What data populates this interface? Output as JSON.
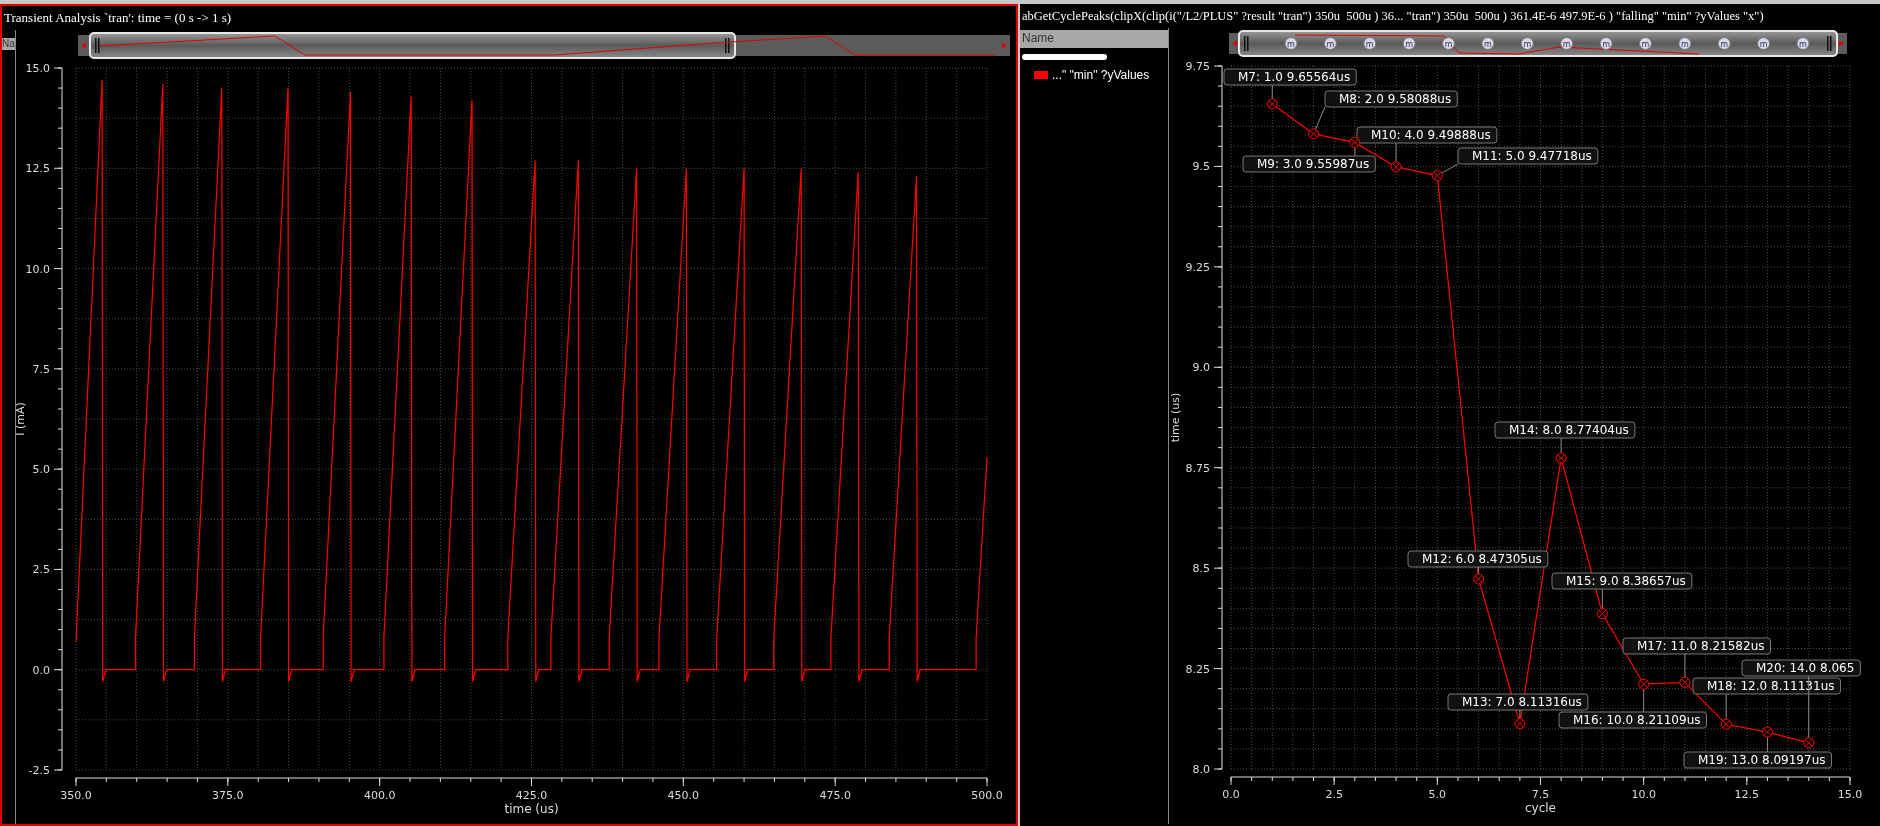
{
  "left_panel": {
    "title": "Transient Analysis `tran': time = (0 s -> 1 s)",
    "legend": {
      "header": "Na"
    },
    "chart_data": {
      "type": "line",
      "grid": true,
      "xlabel": "time (us)",
      "ylabel": "I (mA)",
      "x": [
        350,
        354.3,
        354.4,
        354.9,
        359.8,
        359.8,
        364.3,
        364.4,
        364.9,
        369.5,
        369.5,
        374.0,
        374.1,
        374.6,
        380.4,
        380.4,
        384.9,
        385.0,
        385.5,
        390.7,
        390.7,
        395.2,
        395.3,
        395.8,
        400.7,
        400.7,
        405.2,
        405.3,
        405.8,
        410.7,
        410.7,
        415.2,
        415.3,
        415.8,
        421.1,
        421.1,
        425.6,
        425.7,
        426.2,
        428.2,
        428.2,
        432.7,
        432.8,
        433.3,
        437.8,
        437.8,
        442.3,
        442.4,
        442.9,
        446.0,
        446.0,
        450.5,
        450.6,
        451.1,
        455.5,
        455.5,
        460.0,
        460.1,
        460.6,
        464.9,
        464.9,
        469.4,
        469.5,
        470.0,
        474.3,
        474.3,
        478.8,
        478.9,
        479.4,
        483.9,
        483.9,
        488.4,
        488.5,
        489.0,
        498.2,
        498.2,
        500
      ],
      "series": [
        {
          "color": "#ff0000",
          "values": [
            0.7,
            14.7,
            -0.3,
            0,
            0,
            0.8,
            14.6,
            -0.3,
            0,
            0,
            0.8,
            14.5,
            -0.3,
            0,
            0,
            0.8,
            14.5,
            -0.3,
            0,
            0,
            0.8,
            14.4,
            -0.3,
            0,
            0,
            0.8,
            14.3,
            -0.3,
            0,
            0,
            0.8,
            14.2,
            -0.3,
            0,
            0,
            0.8,
            12.7,
            -0.3,
            0,
            0,
            0.8,
            12.7,
            -0.3,
            0,
            0,
            0.8,
            12.5,
            -0.3,
            0,
            0,
            0.8,
            12.5,
            -0.3,
            0,
            0,
            0.8,
            12.5,
            -0.3,
            0,
            0,
            0.8,
            12.5,
            -0.3,
            0,
            0,
            0.8,
            12.4,
            -0.3,
            0,
            0,
            0.8,
            12.3,
            -0.3,
            0,
            0,
            0.8,
            5.3
          ]
        }
      ],
      "xlim": [
        350,
        500
      ],
      "ylim": [
        -2.5,
        15
      ],
      "xticks": [
        {
          "value": 350,
          "label": "350.0"
        },
        {
          "value": 375,
          "label": "375.0"
        },
        {
          "value": 400,
          "label": "400.0"
        },
        {
          "value": 425,
          "label": "425.0"
        },
        {
          "value": 450,
          "label": "450.0"
        },
        {
          "value": 475,
          "label": "475.0"
        },
        {
          "value": 500,
          "label": "500.0"
        }
      ],
      "yticks": [
        {
          "value": -2.5,
          "label": "-2.5"
        },
        {
          "value": 0,
          "label": "0.0"
        },
        {
          "value": 2.5,
          "label": "2.5"
        },
        {
          "value": 5,
          "label": "5.0"
        },
        {
          "value": 7.5,
          "label": "7.5"
        },
        {
          "value": 10,
          "label": "10.0"
        },
        {
          "value": 12.5,
          "label": "12.5"
        },
        {
          "value": 15,
          "label": "15.0"
        }
      ]
    }
  },
  "right_panel": {
    "title": "abGetCyclePeaks(clipX(clip(i(\"/L2/PLUS\" ?result \"tran\") 350u  500u ) 36... \"tran\") 350u  500u ) 361.4E-6 497.9E-6 ) \"falling\" \"min\" ?yValues \"x\")",
    "legend": {
      "header": "Name",
      "items": [
        {
          "label": "...\" \"min\" ?yValues",
          "color": "#ff0000"
        }
      ]
    },
    "overview": {
      "markers": [
        "m",
        "m",
        "m",
        "m",
        "m",
        "m",
        "m",
        "m",
        "m",
        "m",
        "m",
        "m",
        "m",
        "m"
      ]
    },
    "chart_data": {
      "type": "line",
      "grid": true,
      "xlabel": "cycle",
      "ylabel": "time (us)",
      "x": [
        1,
        2,
        3,
        4,
        5,
        6,
        7,
        8,
        9,
        10,
        11,
        12,
        13,
        14
      ],
      "series": [
        {
          "color": "#ff0000",
          "marker": "circle-x",
          "values": [
            9.65564,
            9.58088,
            9.55987,
            9.49888,
            9.47718,
            8.47305,
            8.11316,
            8.77404,
            8.38657,
            8.21109,
            8.21582,
            8.11131,
            8.09197,
            8.0652
          ]
        }
      ],
      "xlim": [
        0,
        15
      ],
      "ylim": [
        8,
        9.75
      ],
      "xticks": [
        {
          "value": 0,
          "label": "0.0"
        },
        {
          "value": 2.5,
          "label": "2.5"
        },
        {
          "value": 5,
          "label": "5.0"
        },
        {
          "value": 7.5,
          "label": "7.5"
        },
        {
          "value": 10,
          "label": "10.0"
        },
        {
          "value": 12.5,
          "label": "12.5"
        },
        {
          "value": 15,
          "label": "15.0"
        }
      ],
      "yticks": [
        {
          "value": 8,
          "label": "8.0"
        },
        {
          "value": 8.25,
          "label": "8.25"
        },
        {
          "value": 8.5,
          "label": "8.5"
        },
        {
          "value": 8.75,
          "label": "8.75"
        },
        {
          "value": 9,
          "label": "9.0"
        },
        {
          "value": 9.25,
          "label": "9.25"
        },
        {
          "value": 9.5,
          "label": "9.5"
        },
        {
          "value": 9.75,
          "label": "9.75"
        }
      ],
      "annotations": [
        {
          "x": 1,
          "y": 9.65564,
          "text": "M7: 1.0 9.65564us"
        },
        {
          "x": 2,
          "y": 9.58088,
          "text": "M8: 2.0 9.58088us"
        },
        {
          "x": 3,
          "y": 9.55987,
          "text": "M9: 3.0 9.55987us"
        },
        {
          "x": 4,
          "y": 9.49888,
          "text": "M10: 4.0 9.49888us"
        },
        {
          "x": 5,
          "y": 9.47718,
          "text": "M11: 5.0 9.47718us"
        },
        {
          "x": 6,
          "y": 8.47305,
          "text": "M12: 6.0 8.47305us"
        },
        {
          "x": 7,
          "y": 8.11316,
          "text": "M13: 7.0 8.11316us"
        },
        {
          "x": 8,
          "y": 8.77404,
          "text": "M14: 8.0 8.77404us"
        },
        {
          "x": 9,
          "y": 8.38657,
          "text": "M15: 9.0 8.38657us"
        },
        {
          "x": 10,
          "y": 8.21109,
          "text": "M16: 10.0 8.21109us"
        },
        {
          "x": 11,
          "y": 8.21582,
          "text": "M17: 11.0 8.21582us"
        },
        {
          "x": 12,
          "y": 8.11131,
          "text": "M18: 12.0 8.11131us"
        },
        {
          "x": 13,
          "y": 8.09197,
          "text": "M19: 13.0 8.09197us"
        },
        {
          "x": 14,
          "y": 8.0652,
          "text": "M20: 14.0 8.065"
        }
      ]
    }
  }
}
